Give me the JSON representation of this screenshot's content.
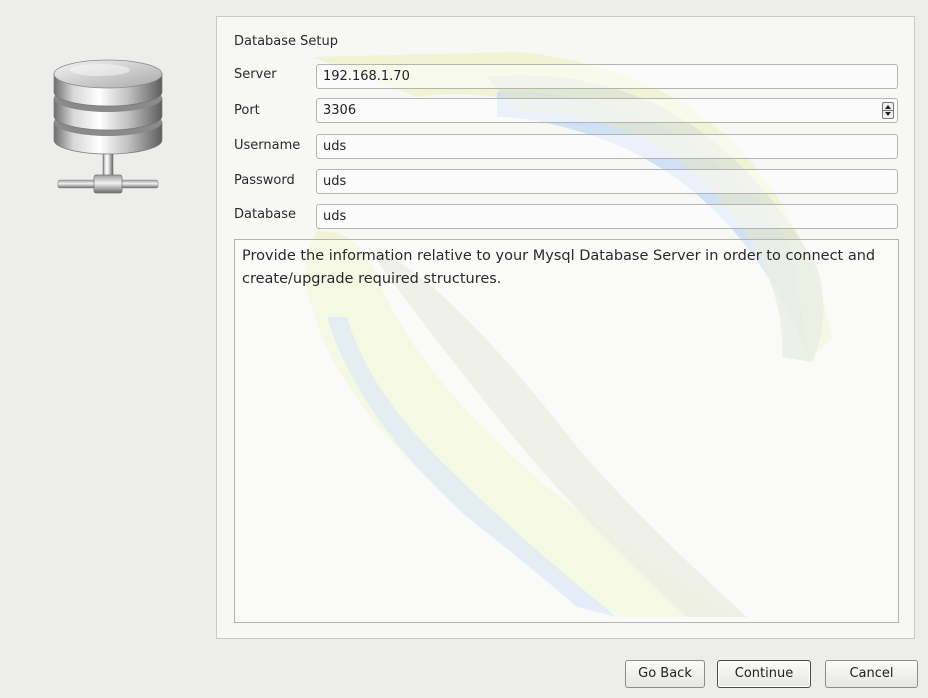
{
  "setup": {
    "group_title": "Database Setup",
    "fields": {
      "server": {
        "label": "Server",
        "value": "192.168.1.70"
      },
      "port": {
        "label": "Port",
        "value": "3306"
      },
      "username": {
        "label": "Username",
        "value": "uds"
      },
      "password": {
        "label": "Password",
        "value": "uds"
      },
      "database": {
        "label": "Database",
        "value": "uds"
      }
    },
    "info_text": "Provide the information relative to your Mysql Database Server in order to connect and create/upgrade required structures."
  },
  "buttons": {
    "go_back": "Go Back",
    "continue": "Continue",
    "cancel": "Cancel"
  },
  "icons": {
    "side_icon": "database-server-icon",
    "watermark": "uds-logo-watermark",
    "spinner": "spinbox-arrows-icon"
  }
}
